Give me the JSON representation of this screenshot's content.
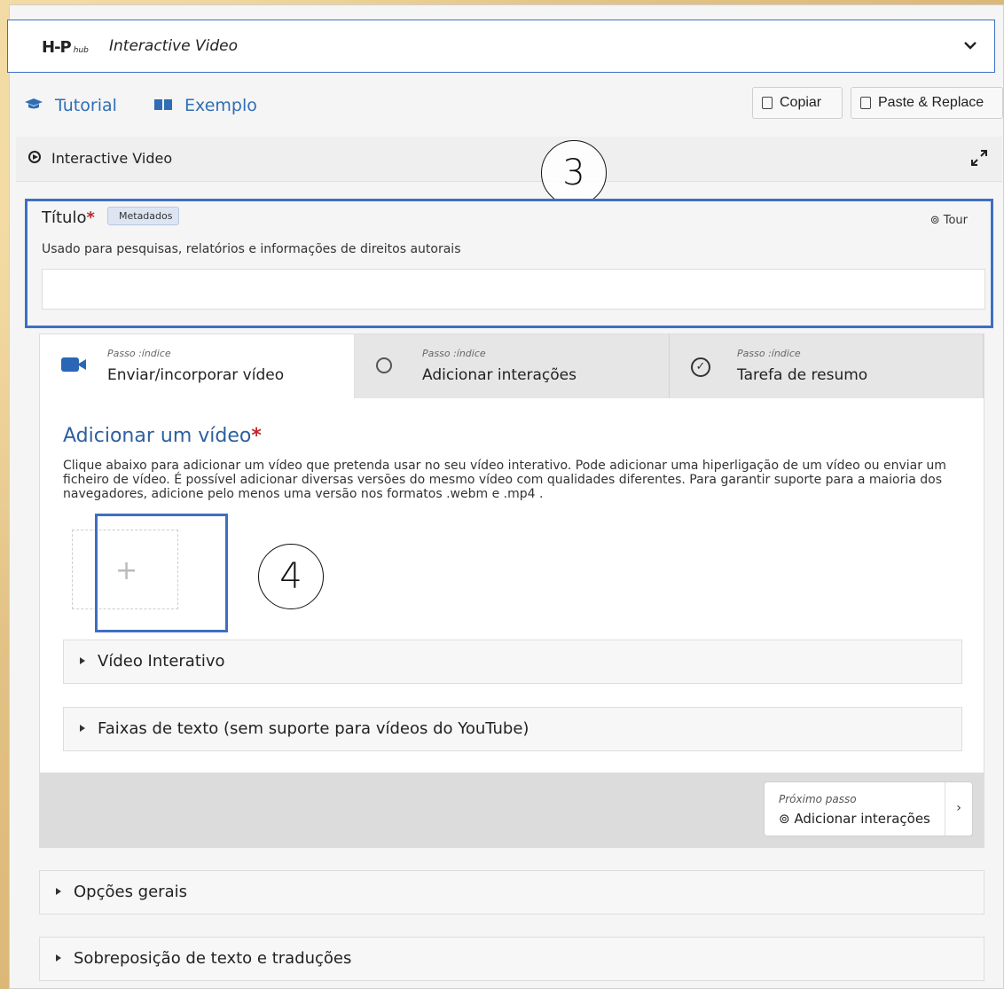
{
  "hub": {
    "logo": "H-P",
    "logo_suffix": "hub",
    "content_type": "Interactive Video",
    "chevron": "chevron-down-icon"
  },
  "links": {
    "tutorial": "Tutorial",
    "example": "Exemplo"
  },
  "actions": {
    "copy": "Copiar",
    "paste_replace": "Paste & Replace"
  },
  "section": {
    "title": "Interactive Video"
  },
  "callouts": {
    "three": "3",
    "four": "4"
  },
  "title_field": {
    "label": "Título",
    "required_mark": "*",
    "badge": "Metadados",
    "tour": "Tour",
    "description": "Usado para pesquisas, relatórios e informações de direitos autorais",
    "value": ""
  },
  "steps": [
    {
      "kicker": "Passo :índice",
      "name": "Enviar/incorporar vídeo",
      "icon": "video-camera-icon",
      "active": true
    },
    {
      "kicker": "Passo :índice",
      "name": "Adicionar interações",
      "icon": "touch-icon",
      "active": false
    },
    {
      "kicker": "Passo :índice",
      "name": "Tarefa de resumo",
      "icon": "check-circle-icon",
      "active": false
    }
  ],
  "add_video": {
    "title": "Adicionar um vídeo",
    "required_mark": "*",
    "description": "Clique abaixo para adicionar um vídeo que pretenda usar no seu vídeo interativo. Pode adicionar uma hiperligação de um vídeo ou enviar um ficheiro de vídeo. É possível adicionar diversas versões do mesmo vídeo com qualidades diferentes. Para garantir suporte para a maioria dos navegadores, adicione pelo menos uma versão nos formatos .webm e .mp4 .",
    "add_symbol": "+"
  },
  "inner_accordions": [
    "Vídeo Interativo",
    "Faixas de texto (sem suporte para vídeos do YouTube)"
  ],
  "next_step": {
    "kicker": "Próximo passo",
    "name": "Adicionar interações",
    "arrow": "›"
  },
  "outer_accordions": [
    "Opções gerais",
    "Sobreposição de texto e traduções"
  ]
}
